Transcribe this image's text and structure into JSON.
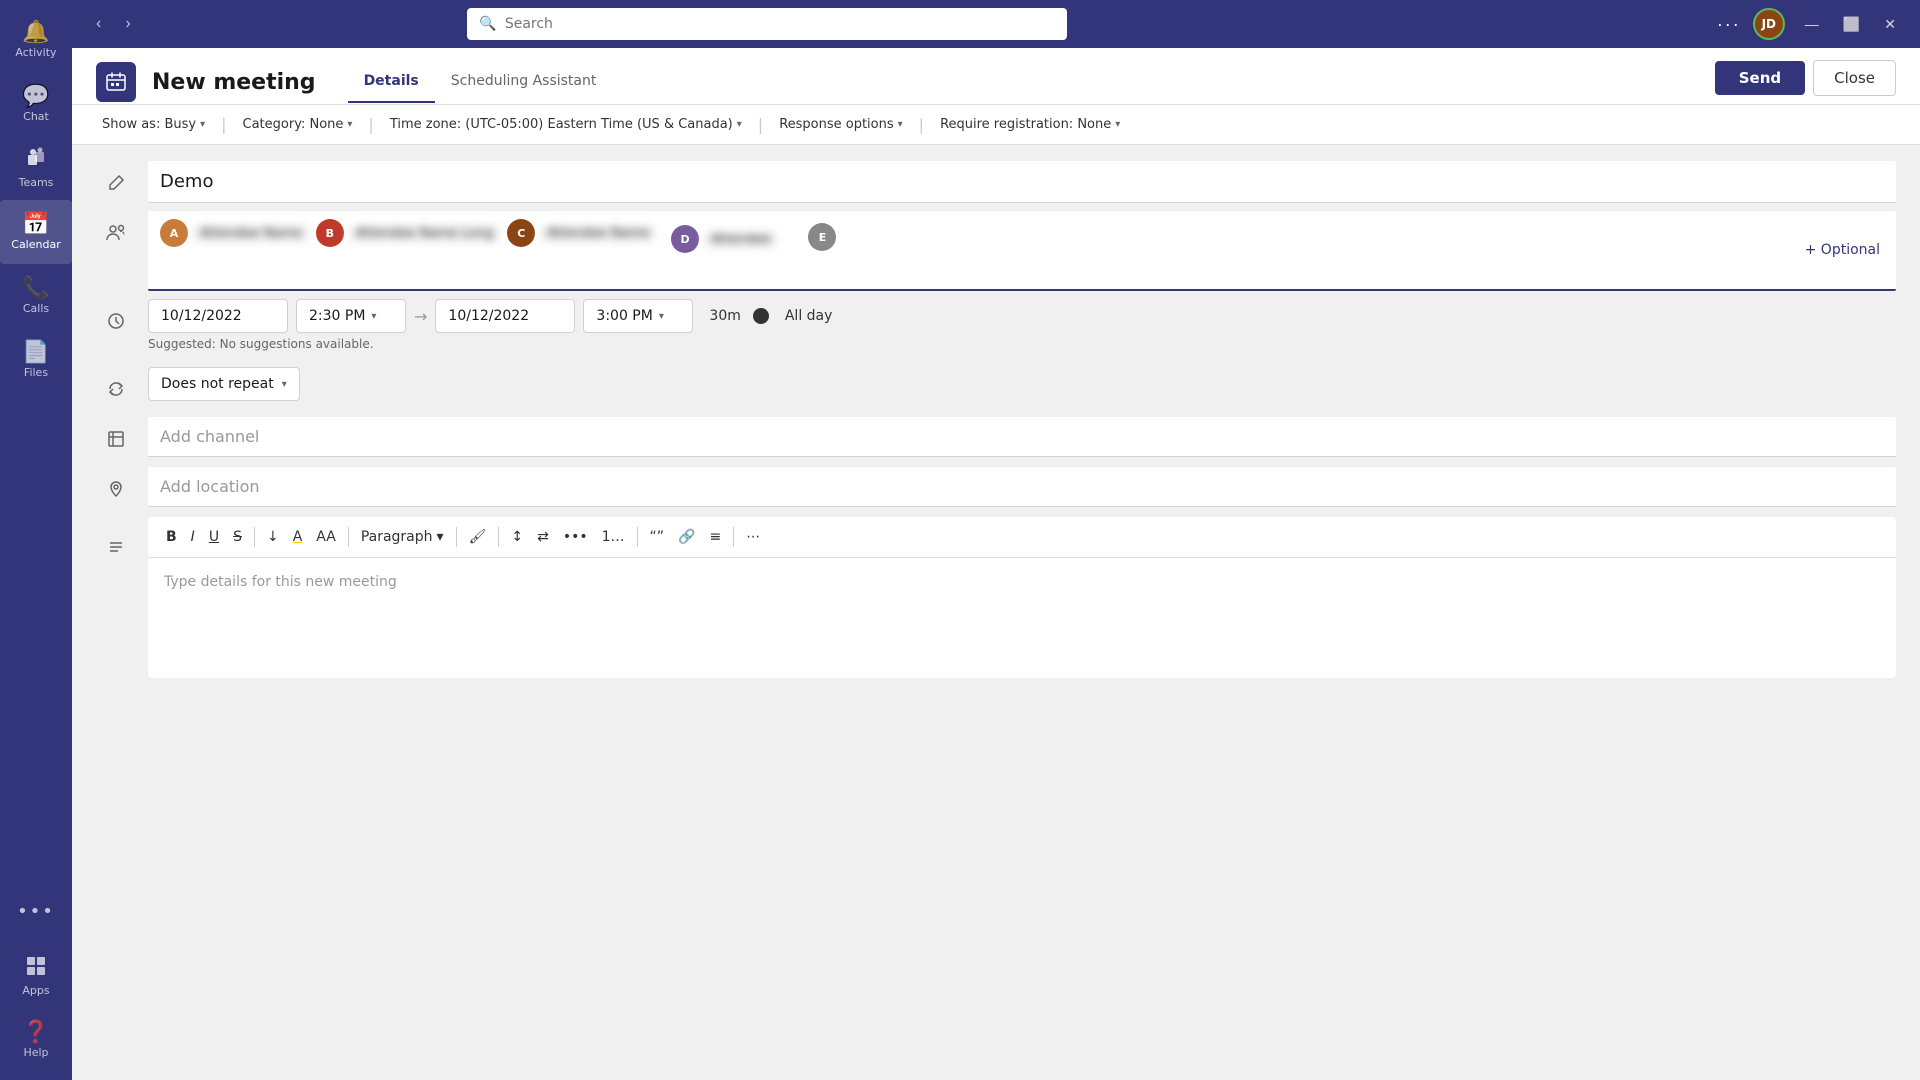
{
  "titlebar": {
    "search_placeholder": "Search",
    "more_options": "···",
    "minimize": "—",
    "maximize": "⬜",
    "close": "✕"
  },
  "sidebar": {
    "items": [
      {
        "id": "activity",
        "label": "Activity",
        "icon": "🔔"
      },
      {
        "id": "chat",
        "label": "Chat",
        "icon": "💬"
      },
      {
        "id": "teams",
        "label": "Teams",
        "icon": "👥"
      },
      {
        "id": "calendar",
        "label": "Calendar",
        "icon": "📅",
        "active": true
      },
      {
        "id": "calls",
        "label": "Calls",
        "icon": "📞"
      },
      {
        "id": "files",
        "label": "Files",
        "icon": "📄"
      }
    ],
    "bottom_items": [
      {
        "id": "more",
        "label": "···",
        "icon": "···"
      },
      {
        "id": "apps",
        "label": "Apps",
        "icon": "⊞"
      },
      {
        "id": "help",
        "label": "Help",
        "icon": "❓"
      }
    ]
  },
  "meeting": {
    "icon": "▦",
    "title": "New meeting",
    "tabs": [
      {
        "id": "details",
        "label": "Details",
        "active": true
      },
      {
        "id": "scheduling",
        "label": "Scheduling Assistant",
        "active": false
      }
    ],
    "send_label": "Send",
    "close_label": "Close"
  },
  "toolbar": {
    "show_as_label": "Show as: Busy",
    "category_label": "Category: None",
    "timezone_label": "Time zone: (UTC-05:00) Eastern Time (US & Canada)",
    "response_label": "Response options",
    "registration_label": "Require registration: None"
  },
  "form": {
    "title_placeholder": "Demo",
    "attendees_optional": "+ Optional",
    "start_date": "10/12/2022",
    "start_time": "2:30 PM",
    "end_date": "10/12/2022",
    "end_time": "3:00 PM",
    "duration": "30m",
    "allday_label": "All day",
    "suggested_label": "Suggested: No suggestions available.",
    "repeat_label": "Does not repeat",
    "channel_placeholder": "Add channel",
    "location_placeholder": "Add location",
    "editor_placeholder": "Type details for this new meeting",
    "attendees": [
      {
        "color": "#c97b3a",
        "name": "Attendee 1"
      },
      {
        "color": "#c0392b",
        "name": "Attendee 2"
      },
      {
        "color": "#8B4513",
        "name": "Attendee 3"
      },
      {
        "color": "#7a5c9e",
        "name": "Attendee 4"
      }
    ]
  },
  "editor": {
    "toolbar_items": [
      {
        "id": "bold",
        "label": "B",
        "type": "bold"
      },
      {
        "id": "italic",
        "label": "I",
        "type": "italic"
      },
      {
        "id": "underline",
        "label": "U",
        "type": "underline"
      },
      {
        "id": "strikethrough",
        "label": "S",
        "type": "strike"
      },
      {
        "id": "decrease-indent",
        "label": "⇤"
      },
      {
        "id": "highlight",
        "label": "A"
      },
      {
        "id": "font-size",
        "label": "AA"
      },
      {
        "id": "paragraph",
        "label": "Paragraph ▾"
      },
      {
        "id": "format-painter",
        "label": "🖌"
      },
      {
        "id": "align-left",
        "label": "≡"
      },
      {
        "id": "align-right",
        "label": "≡"
      },
      {
        "id": "bullet-list",
        "label": "≡"
      },
      {
        "id": "numbered-list",
        "label": "≡"
      },
      {
        "id": "quote",
        "label": "\"\""
      },
      {
        "id": "link",
        "label": "🔗"
      },
      {
        "id": "align",
        "label": "≡"
      },
      {
        "id": "more-formatting",
        "label": "···"
      }
    ]
  }
}
